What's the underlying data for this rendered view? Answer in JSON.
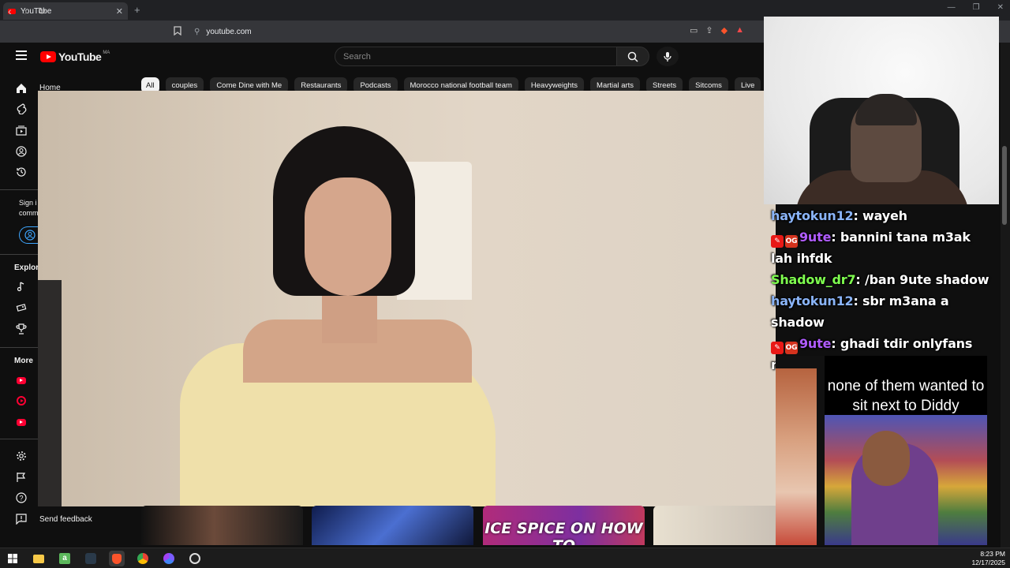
{
  "browser": {
    "tab_title": "YouTube",
    "tab_close": "✕",
    "new_tab": "+",
    "url": "youtube.com",
    "window_controls": [
      "—",
      "❐",
      "✕"
    ]
  },
  "youtube": {
    "logo_text": "YouTube",
    "country_code": "MA",
    "search_placeholder": "Search",
    "chips": [
      "All",
      "couples",
      "Come Dine with Me",
      "Restaurants",
      "Podcasts",
      "Morocco national football team",
      "Heavyweights",
      "Martial arts",
      "Streets",
      "Sitcoms",
      "Live"
    ],
    "sidebar": {
      "home_label": "Home",
      "signin_text_1": "Sign i",
      "signin_text_2": "comm",
      "explore_label": "Explor",
      "more_label": "More",
      "send_feedback": "Send feedback"
    },
    "thumb_caption": "ICE SPICE ON HOW TO"
  },
  "stream": {
    "chat": [
      {
        "user": "haytokun12",
        "user_color": "#8ab4f8",
        "badges": [],
        "text": "wayeh"
      },
      {
        "user": "9ute",
        "user_color": "#b05cff",
        "badges": [
          "🎤",
          "OG"
        ],
        "text": "bannini tana m3ak lah ihfdk"
      },
      {
        "user": "Shadow_dr7",
        "user_color": "#7fff4f",
        "badges": [],
        "text": "/ban 9ute shadow"
      },
      {
        "user": "haytokun12",
        "user_color": "#8ab4f8",
        "badges": [],
        "text": "sbr m3ana a shadow"
      },
      {
        "user": "9ute",
        "user_color": "#b05cff",
        "badges": [
          "🎤",
          "OG"
        ],
        "text": "ghadi tdir onlyfans mora had show"
      }
    ],
    "side_video_caption": "none of them wanted to sit next to Diddy"
  },
  "taskbar": {
    "time": "8:23 PM",
    "date": "12/17/2025"
  },
  "colors": {
    "youtube_red": "#ff0000",
    "chip_active_bg": "#f1f1f1",
    "page_bg": "#0f0f0f"
  }
}
